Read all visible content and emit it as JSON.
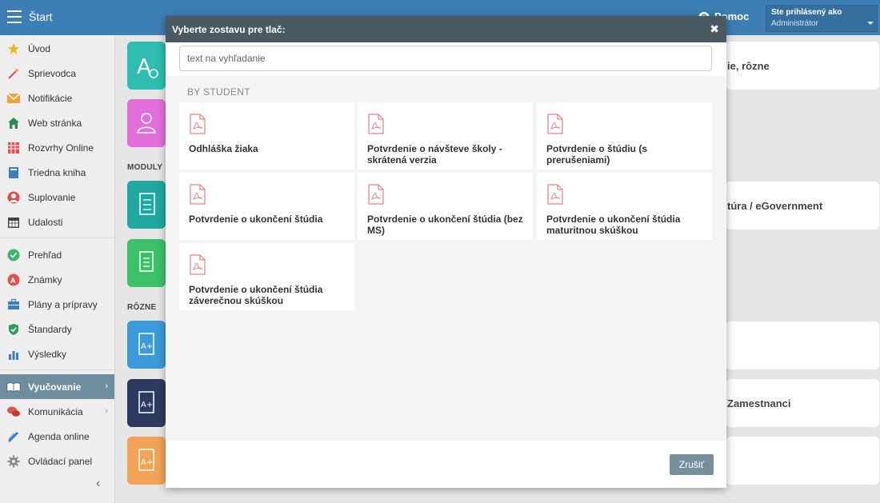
{
  "topbar": {
    "title": "Štart",
    "help_label": "Pomoc",
    "user_line1": "Ste prihlásený ako",
    "user_line2": "Administrátor"
  },
  "sidebar": {
    "group1": [
      {
        "label": "Úvod",
        "icon": "star-icon"
      },
      {
        "label": "Sprievodca",
        "icon": "magic-wand-icon"
      },
      {
        "label": "Notifikácie",
        "icon": "envelope-icon"
      },
      {
        "label": "Web stránka",
        "icon": "house-icon"
      },
      {
        "label": "Rozvrhy Online",
        "icon": "timetable-icon"
      },
      {
        "label": "Triedna kniha",
        "icon": "book-icon"
      },
      {
        "label": "Suplovanie",
        "icon": "person-icon"
      },
      {
        "label": "Udalosti",
        "icon": "calendar-icon"
      }
    ],
    "group2": [
      {
        "label": "Prehľad",
        "icon": "check-circle-icon"
      },
      {
        "label": "Známky",
        "icon": "grade-icon"
      },
      {
        "label": "Plány a prípravy",
        "icon": "briefcase-icon"
      },
      {
        "label": "Štandardy",
        "icon": "shield-check-icon"
      },
      {
        "label": "Výsledky",
        "icon": "bar-chart-icon"
      }
    ],
    "group3": [
      {
        "label": "Vyučovanie",
        "icon": "open-book-icon",
        "active": true
      },
      {
        "label": "Komunikácia",
        "icon": "chat-bubbles-icon"
      },
      {
        "label": "Agenda online",
        "icon": "pencil-icon"
      },
      {
        "label": "Ovládací panel",
        "icon": "gear-icon"
      }
    ]
  },
  "main": {
    "section_moduly": "MODULY",
    "section_rozne": "RÔZNE",
    "cards": [
      "ie, rôzne",
      "túra / eGovernment",
      "Zamestnanci"
    ]
  },
  "modal": {
    "title": "Vyberte zostavu pre tlač:",
    "search_placeholder": "text na vyhľadanie",
    "group_label": "BY STUDENT",
    "reports": [
      "Odhláška žiaka",
      "Potvrdenie o návšteve školy - skrátená verzia",
      "Potvrdenie o štúdiu (s prerušeniami)",
      "Potvrdenie o ukončení štúdia",
      "Potvrdenie o ukončení štúdia (bez MS)",
      "Potvrdenie o ukončení štúdia maturitnou skúškou",
      "Potvrdenie o ukončení štúdia záverečnou skúškou"
    ],
    "cancel_label": "Zrušiť"
  },
  "colors": {
    "topbar": "#3d7fb4",
    "modal_header": "#4a5a63",
    "active_nav": "#6e8d9e",
    "pdf_icon": "#f08080",
    "cancel_button": "#778f9b"
  }
}
